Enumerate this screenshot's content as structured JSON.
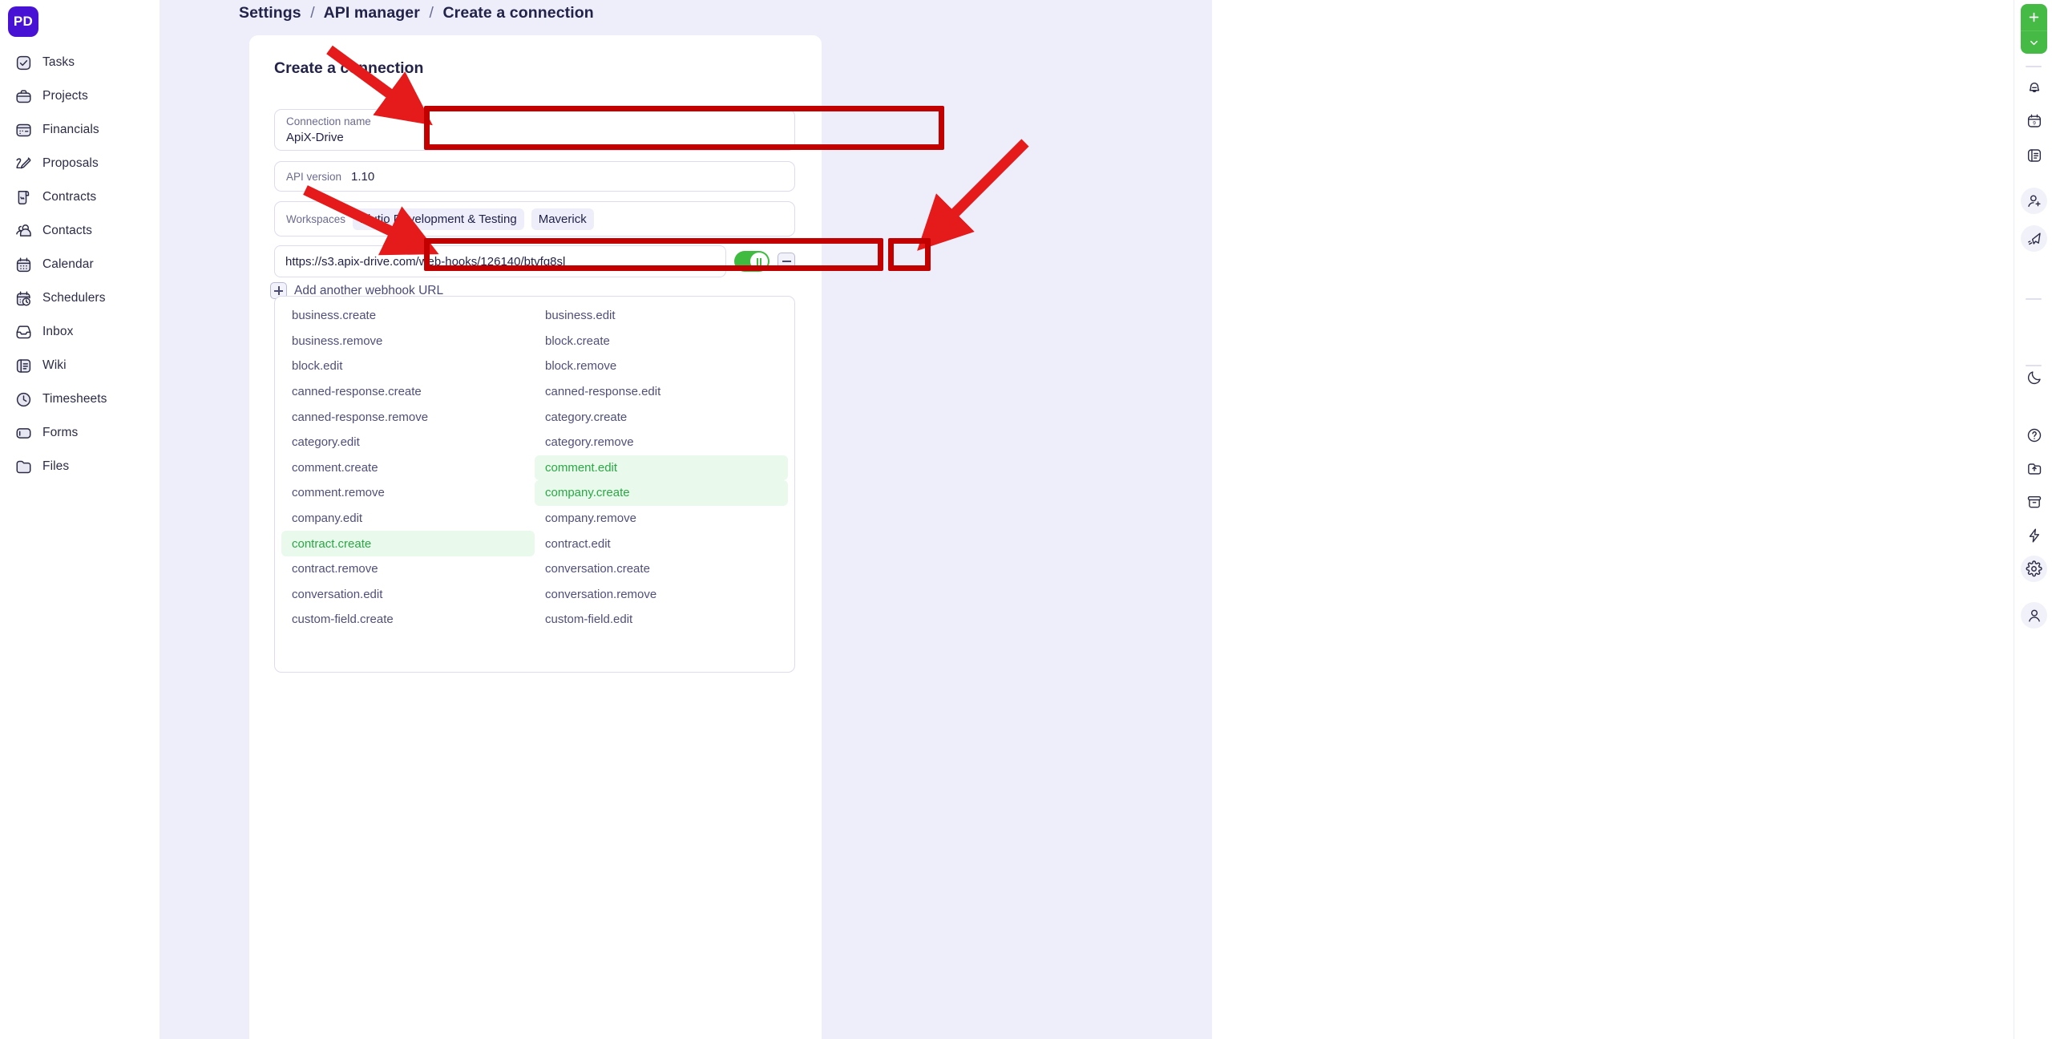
{
  "app": {
    "brand_initials": "PD",
    "accent_purple": "#4712d4",
    "accent_green": "#45bb45",
    "panel_bg": "#eeeefb",
    "annotation_color": "#c20000",
    "selected_event_color": "#2aa845"
  },
  "sidebar": {
    "items": [
      {
        "label": "Tasks",
        "icon": "check-square-icon"
      },
      {
        "label": "Projects",
        "icon": "briefcase-icon"
      },
      {
        "label": "Financials",
        "icon": "wallet-icon"
      },
      {
        "label": "Proposals",
        "icon": "pencil-icon"
      },
      {
        "label": "Contracts",
        "icon": "scroll-signature-icon"
      },
      {
        "label": "Contacts",
        "icon": "people-icon"
      },
      {
        "label": "Calendar",
        "icon": "calendar-icon"
      },
      {
        "label": "Schedulers",
        "icon": "calendar-clock-icon"
      },
      {
        "label": "Inbox",
        "icon": "inbox-icon"
      },
      {
        "label": "Wiki",
        "icon": "book-icon"
      },
      {
        "label": "Timesheets",
        "icon": "clock-icon"
      },
      {
        "label": "Forms",
        "icon": "form-icon"
      },
      {
        "label": "Files",
        "icon": "folder-icon"
      }
    ]
  },
  "breadcrumb": {
    "items": [
      "Settings",
      "API manager",
      "Create a connection"
    ],
    "separator": "/"
  },
  "card": {
    "title": "Create a connection",
    "connection_name": {
      "label": "Connection name",
      "value": "ApiX-Drive"
    },
    "api_version": {
      "label": "API version",
      "value": "1.10"
    },
    "workspaces": {
      "label": "Workspaces",
      "tags": [
        "Plutio Development & Testing",
        "Maverick"
      ]
    },
    "webhook": {
      "url": "https://s3.apix-drive.com/web-hooks/126140/btvfg8sl",
      "toggle_on": true,
      "toggle_icon": "pause-icon",
      "remove_icon": "minus-icon"
    },
    "add_another": {
      "label": "Add another webhook URL",
      "icon": "plus-box-icon"
    },
    "events_left": [
      {
        "name": "business.create",
        "selected": false
      },
      {
        "name": "business.remove",
        "selected": false
      },
      {
        "name": "block.edit",
        "selected": false
      },
      {
        "name": "canned-response.create",
        "selected": false
      },
      {
        "name": "canned-response.remove",
        "selected": false
      },
      {
        "name": "category.edit",
        "selected": false
      },
      {
        "name": "comment.create",
        "selected": false
      },
      {
        "name": "comment.remove",
        "selected": false
      },
      {
        "name": "company.edit",
        "selected": false
      },
      {
        "name": "contract.create",
        "selected": true
      },
      {
        "name": "contract.remove",
        "selected": false
      },
      {
        "name": "conversation.edit",
        "selected": false
      },
      {
        "name": "custom-field.create",
        "selected": false
      }
    ],
    "events_right": [
      {
        "name": "business.edit",
        "selected": false
      },
      {
        "name": "block.create",
        "selected": false
      },
      {
        "name": "block.remove",
        "selected": false
      },
      {
        "name": "canned-response.edit",
        "selected": false
      },
      {
        "name": "category.create",
        "selected": false
      },
      {
        "name": "category.remove",
        "selected": false
      },
      {
        "name": "comment.edit",
        "selected": true
      },
      {
        "name": "company.create",
        "selected": true
      },
      {
        "name": "company.remove",
        "selected": false
      },
      {
        "name": "contract.edit",
        "selected": false
      },
      {
        "name": "conversation.create",
        "selected": false
      },
      {
        "name": "conversation.remove",
        "selected": false
      },
      {
        "name": "custom-field.edit",
        "selected": false
      }
    ]
  },
  "right_rail": {
    "add_button": {
      "plus_icon": "plus-icon",
      "chevron_icon": "chevron-down-icon"
    },
    "buttons": [
      {
        "icon": "bell-icon"
      },
      {
        "icon": "calendar-day-icon"
      },
      {
        "icon": "notebook-icon"
      },
      {
        "icon": "add-person-icon"
      },
      {
        "icon": "paper-plane-icon"
      },
      {
        "icon": "moon-icon"
      },
      {
        "icon": "help-circle-icon"
      },
      {
        "icon": "share-icon"
      },
      {
        "icon": "archive-icon"
      },
      {
        "icon": "bolt-icon"
      },
      {
        "icon": "gear-icon"
      },
      {
        "icon": "person-icon"
      }
    ]
  }
}
